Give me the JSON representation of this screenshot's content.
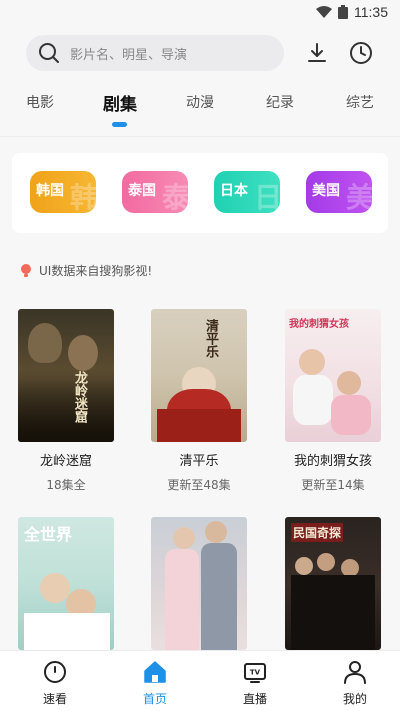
{
  "status_bar": {
    "time": "11:35"
  },
  "search": {
    "placeholder": "影片名、明星、导演"
  },
  "tabs": [
    {
      "label": "电影"
    },
    {
      "label": "剧集"
    },
    {
      "label": "动漫"
    },
    {
      "label": "纪录"
    },
    {
      "label": "综艺"
    }
  ],
  "active_tab": "剧集",
  "regions": [
    {
      "label": "韩国",
      "char": "韩",
      "color_from": "#f0a21a",
      "color_to": "#f7b733"
    },
    {
      "label": "泰国",
      "char": "泰",
      "color_from": "#f26aa0",
      "color_to": "#f78bb5"
    },
    {
      "label": "日本",
      "char": "日",
      "color_from": "#1fd1b2",
      "color_to": "#3fe0c0"
    },
    {
      "label": "美国",
      "char": "美",
      "color_from": "#a33be8",
      "color_to": "#c052f0"
    }
  ],
  "notice": {
    "text": "UI数据来自搜狗影视!"
  },
  "posters": [
    {
      "title": "龙岭迷窟",
      "subtitle": "18集全",
      "poster_text": "龙岭迷窟"
    },
    {
      "title": "清平乐",
      "subtitle": "更新至48集",
      "poster_text": "清平乐"
    },
    {
      "title": "我的刺猬女孩",
      "subtitle": "更新至14集",
      "poster_text": "我的刺猬女孩"
    },
    {
      "title": "",
      "subtitle": "",
      "poster_text": "全世界"
    },
    {
      "title": "",
      "subtitle": "",
      "poster_text": ""
    },
    {
      "title": "",
      "subtitle": "",
      "poster_text": "民国奇探"
    }
  ],
  "bottom_nav": [
    {
      "label": "速看",
      "icon": "clock-icon"
    },
    {
      "label": "首页",
      "icon": "home-icon"
    },
    {
      "label": "直播",
      "icon": "tv-icon"
    },
    {
      "label": "我的",
      "icon": "person-icon"
    }
  ],
  "active_nav": "首页",
  "colors": {
    "accent": "#1e90e6",
    "notice_bulb": "#f26a5a"
  }
}
